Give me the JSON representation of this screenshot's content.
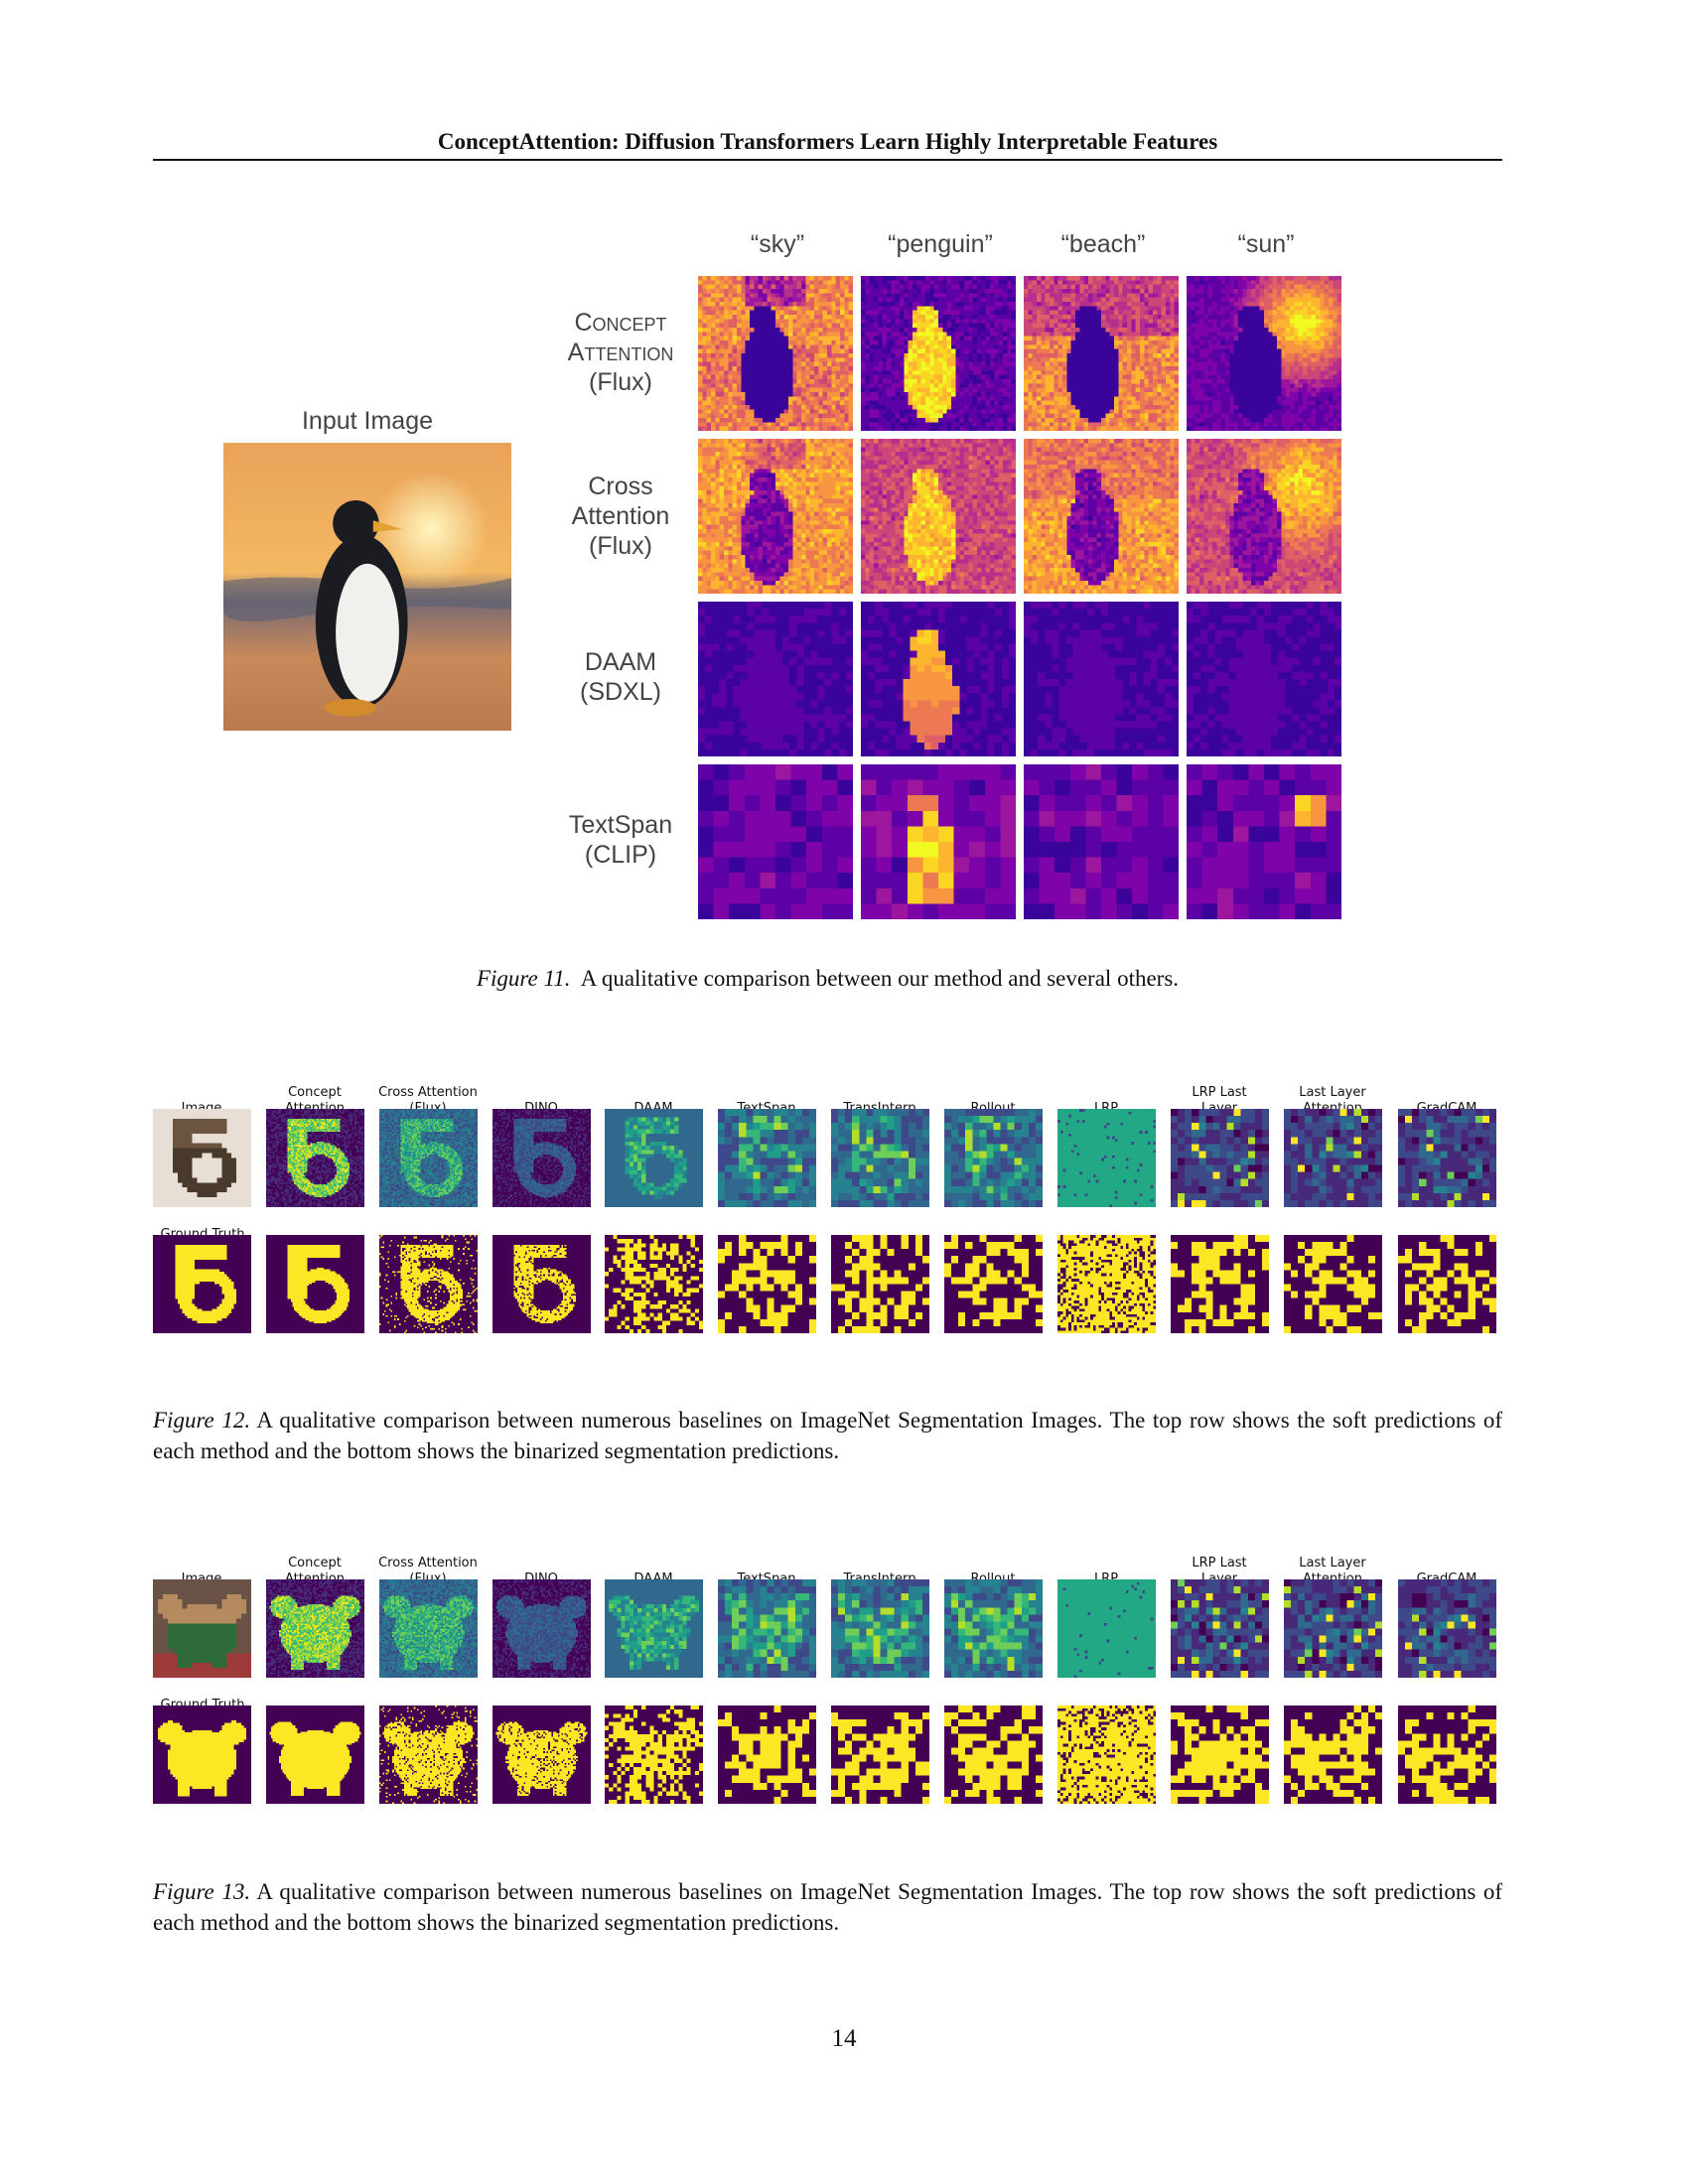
{
  "header": {
    "title": "ConceptAttention: Diffusion Transformers Learn Highly Interpretable Features"
  },
  "figure11": {
    "input_label": "Input Image",
    "concepts": [
      "“sky”",
      "“penguin”",
      "“beach”",
      "“sun”"
    ],
    "methods": [
      {
        "line1": "Concept",
        "line2": "Attention",
        "line3": "(Flux)"
      },
      {
        "line1": "Cross",
        "line2": "Attention",
        "line3": "(Flux)"
      },
      {
        "line1": "DAAM",
        "line2": "(SDXL)"
      },
      {
        "line1": "TextSpan",
        "line2": "(CLIP)"
      }
    ],
    "caption_label": "Figure 11.",
    "caption_text": "A qualitative comparison between our method and several others."
  },
  "seg_headers": [
    {
      "l1": "",
      "l2": "Image"
    },
    {
      "l1": "Concept",
      "l2": "Attention"
    },
    {
      "l1": "Cross Attention",
      "l2": "(Flux)"
    },
    {
      "l1": "",
      "l2": "DINO"
    },
    {
      "l1": "",
      "l2": "DAAM"
    },
    {
      "l1": "",
      "l2": "TextSpan"
    },
    {
      "l1": "",
      "l2": "TransInterp"
    },
    {
      "l1": "",
      "l2": "Rollout"
    },
    {
      "l1": "",
      "l2": "LRP"
    },
    {
      "l1": "LRP Last",
      "l2": "Layer"
    },
    {
      "l1": "Last Layer",
      "l2": "Attention"
    },
    {
      "l1": "",
      "l2": "GradCAM"
    }
  ],
  "ground_truth_label": "Ground Truth",
  "figure12": {
    "caption_label": "Figure 12.",
    "caption_text": "A qualitative comparison between numerous baselines on ImageNet Segmentation Images.  The top row shows the soft predictions of each method and the bottom shows the binarized segmentation predictions."
  },
  "figure13": {
    "caption_label": "Figure 13.",
    "caption_text": "A qualitative comparison between numerous baselines on ImageNet Segmentation Images.  The top row shows the soft predictions of each method and the bottom shows the binarized segmentation predictions."
  },
  "page_number": "14",
  "colors": {
    "plasma_dark": "#3a049a",
    "plasma_bright": "#f0f921",
    "viridis_dark": "#440154",
    "viridis_bright": "#fde725",
    "lrp_teal": "#22a884"
  }
}
